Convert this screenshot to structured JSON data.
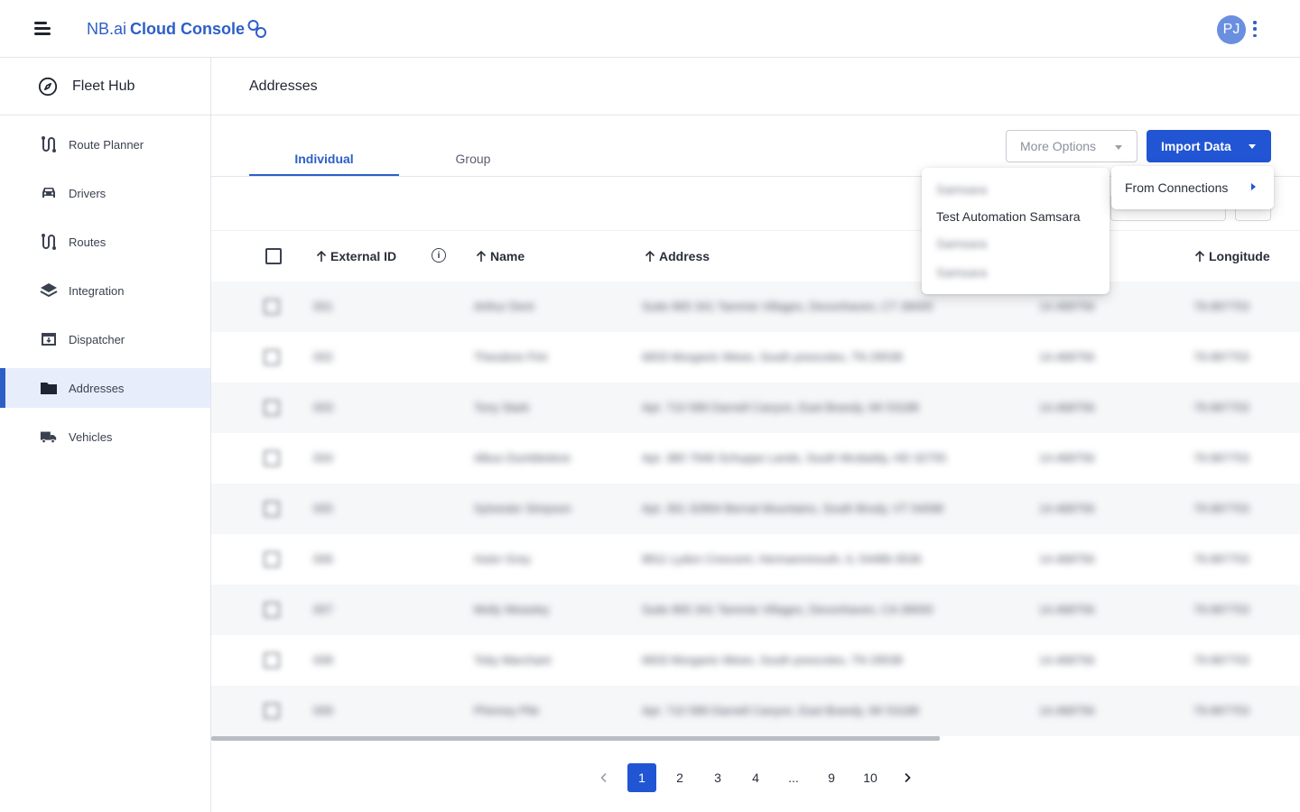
{
  "header": {
    "brand_prefix": "NB.ai",
    "brand_name": "Cloud Console",
    "avatar_initials": "PJ"
  },
  "sidebar": {
    "section_title": "Fleet Hub",
    "items": [
      {
        "label": "Route Planner",
        "icon": "route-icon"
      },
      {
        "label": "Drivers",
        "icon": "car-icon"
      },
      {
        "label": "Routes",
        "icon": "route-icon"
      },
      {
        "label": "Integration",
        "icon": "layers-icon"
      },
      {
        "label": "Dispatcher",
        "icon": "dispatcher-icon"
      },
      {
        "label": "Addresses",
        "icon": "folder-icon",
        "active": true
      },
      {
        "label": "Vehicles",
        "icon": "truck-icon"
      }
    ]
  },
  "page": {
    "title": "Addresses",
    "tabs": [
      "Individual",
      "Group"
    ],
    "active_tab": "Individual",
    "more_options_label": "More Options",
    "import_data_label": "Import Data"
  },
  "import_menu": {
    "from_connections_label": "From Connections",
    "connections": [
      {
        "label": "Samsara",
        "obscured": true
      },
      {
        "label": "Test Automation Samsara",
        "obscured": false
      },
      {
        "label": "Samsara",
        "obscured": true
      },
      {
        "label": "Samsara",
        "obscured": true
      }
    ]
  },
  "table": {
    "columns": [
      "External ID",
      "Name",
      "Address",
      "Longitude"
    ],
    "rows": [
      {
        "id": "001",
        "name": "Arthur Dent",
        "address": "Suite 865 341 Tammie Villages, Devonhaven, CT 39000",
        "lat": "14.468756",
        "lng": "79.997753"
      },
      {
        "id": "002",
        "name": "Theodore Fint",
        "address": "6833 Morganic Mews, South prescotes, TN 29538",
        "lat": "14.468756",
        "lng": "79.997753"
      },
      {
        "id": "003",
        "name": "Tony Stark",
        "address": "Apt. 710 589 Darnell Canyon, East Brandy, WI 53188",
        "lat": "14.468756",
        "lng": "79.997753"
      },
      {
        "id": "004",
        "name": "Albus Dumbledore",
        "address": "Apt. 380 7946 Schuppe Lands, South Mcdaddy, HD 32755",
        "lat": "14.468756",
        "lng": "79.997753"
      },
      {
        "id": "005",
        "name": "Sylvester Simpson",
        "address": "Apt. 391 32894 Bernal Mountains, South Brody, VT 54098",
        "lat": "14.468756",
        "lng": "79.997753"
      },
      {
        "id": "006",
        "name": "Hulor Grey",
        "address": "8811 Lydon Crescent, Hermannmouth, IL 54486-3536",
        "lat": "14.468756",
        "lng": "79.997753"
      },
      {
        "id": "007",
        "name": "Molly Weasley",
        "address": "Suite 865 341 Tammie Villages, Devonhaven, CA 39000",
        "lat": "14.468756",
        "lng": "79.997753"
      },
      {
        "id": "008",
        "name": "Toby Marchant",
        "address": "6833 Morganic Mews, South prescotes, TN 29538",
        "lat": "14.468756",
        "lng": "79.997753"
      },
      {
        "id": "009",
        "name": "Phinney Pile",
        "address": "Apt. 710 589 Darnell Canyon, East Brandy, WI 53188",
        "lat": "14.468756",
        "lng": "79.997753"
      }
    ]
  },
  "pagination": {
    "pages": [
      "1",
      "2",
      "3",
      "4",
      "...",
      "9",
      "10"
    ],
    "current": "1"
  },
  "colors": {
    "accent": "#2155d4",
    "brand": "#2d5fc7",
    "active_nav_bg": "#e8edfb"
  }
}
